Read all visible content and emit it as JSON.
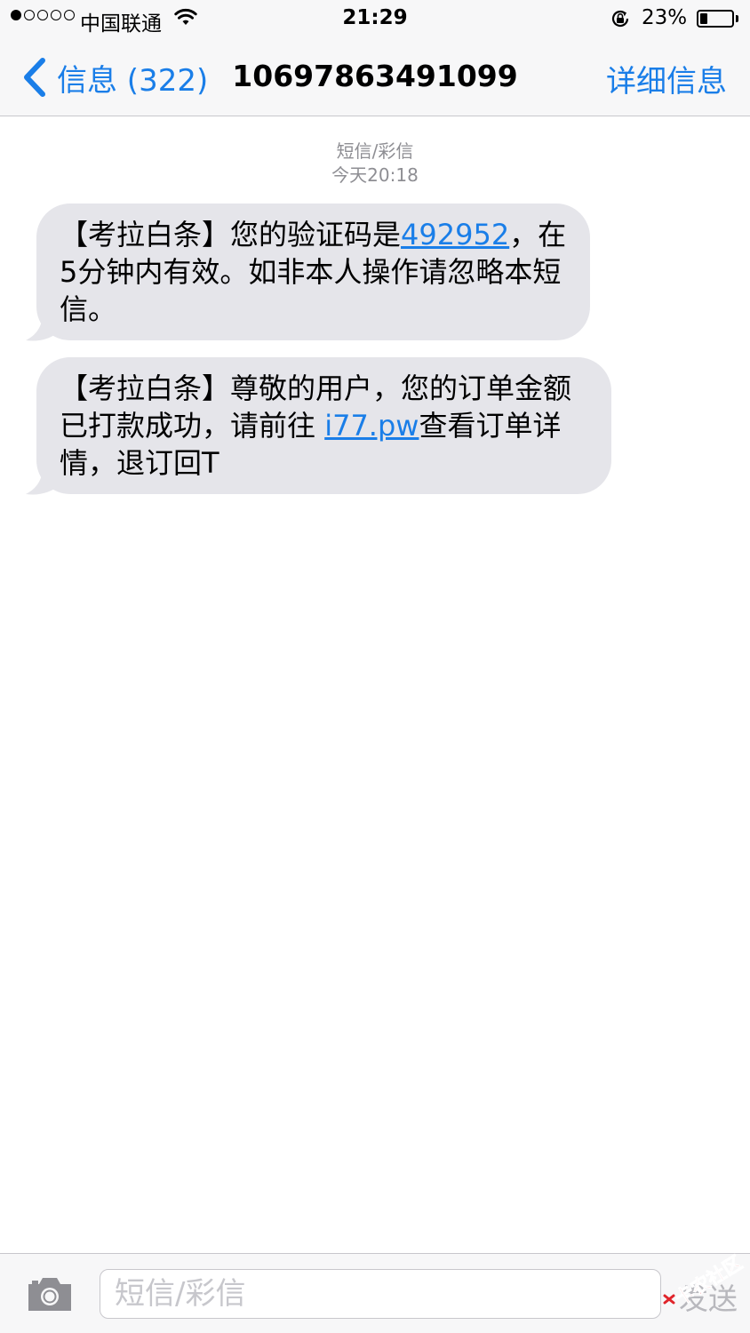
{
  "status_bar": {
    "carrier": "中国联通",
    "time": "21:29",
    "battery_percent": "23%",
    "battery_level": 0.23,
    "signal_strength": 1,
    "signal_max": 5
  },
  "nav": {
    "back_label": "信息 (322)",
    "title": "10697863491099",
    "details_label": "详细信息"
  },
  "thread": {
    "message_type": "短信/彩信",
    "timestamp": "今天20:18"
  },
  "messages": [
    {
      "before_link": "【考拉白条】您的验证码是",
      "link": "492952",
      "after_link": "，在5分钟内有效。如非本人操作请忽略本短信。"
    },
    {
      "before_link": "【考拉白条】尊敬的用户，您的订单金额已打款成功，请前往 ",
      "link": "i77.pw",
      "after_link": "查看订单详情，退订回T"
    }
  ],
  "composer": {
    "placeholder": "短信/彩信",
    "send_label": "发送"
  },
  "watermark": {
    "text": "卡农社区"
  },
  "colors": {
    "accent": "#1a7ee8",
    "bubble": "#e5e5ea",
    "bar_background": "#f7f7f8",
    "timestamp": "#8e8e93",
    "watermark_red": "#e0242a"
  },
  "icons": {
    "back": "chevron-left-icon",
    "wifi": "wifi-icon",
    "rotation_lock": "rotation-lock-icon",
    "battery": "battery-icon",
    "camera": "camera-icon"
  }
}
